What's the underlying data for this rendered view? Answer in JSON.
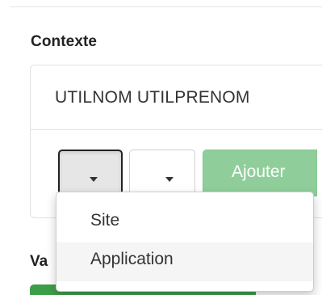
{
  "section": {
    "title": "Contexte",
    "partial_label": "Va"
  },
  "user": {
    "name": "UTILNOM UTILPRENOM"
  },
  "toolbar": {
    "add_label": "Ajouter"
  },
  "dropdown": {
    "items": [
      {
        "label": "Site"
      },
      {
        "label": "Application"
      }
    ],
    "hovered_item": "Application"
  },
  "colors": {
    "add_button": "#8fce9a",
    "primary_green": "#3d9e4a",
    "active_toggle": "#e6e6e6"
  }
}
